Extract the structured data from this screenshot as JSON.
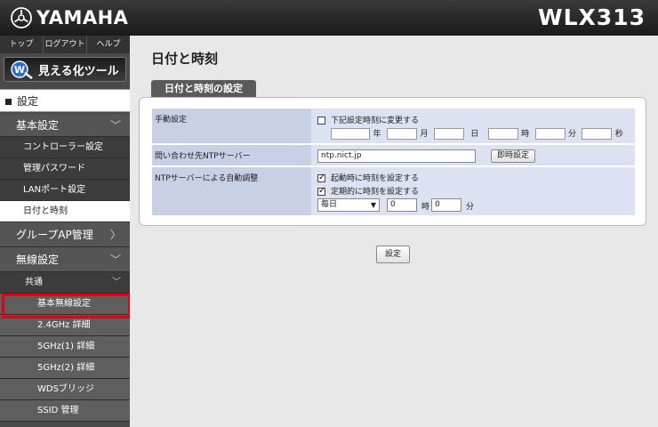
{
  "header": {
    "brand": "YAMAHA",
    "model": "WLX313"
  },
  "sidebar": {
    "top_links": [
      "トップ",
      "ログアウト",
      "ヘルプ"
    ],
    "viz_button": "見える化ツール",
    "section_title": "設定",
    "items": [
      {
        "label": "基本設定",
        "chevron": "﹀"
      },
      {
        "label": "コントローラー設定"
      },
      {
        "label": "管理パスワード"
      },
      {
        "label": "LANポート設定"
      },
      {
        "label": "日付と時刻"
      },
      {
        "label": "グループAP管理",
        "chevron": "〉"
      },
      {
        "label": "無線設定",
        "chevron": "﹀"
      },
      {
        "label": "共通",
        "chevron": "﹀"
      },
      {
        "label": "基本無線設定"
      },
      {
        "label": "2.4GHz 詳細"
      },
      {
        "label": "5GHz(1) 詳細"
      },
      {
        "label": "5GHz(2) 詳細"
      },
      {
        "label": "WDSブリッジ"
      },
      {
        "label": "SSID 管理"
      }
    ]
  },
  "main": {
    "title": "日付と時刻",
    "tab": "日付と時刻の設定",
    "manual": {
      "label": "手動設定",
      "checkbox": "下記設定時刻に変更する",
      "units": [
        "年",
        "月",
        "日",
        "時",
        "分",
        "秒"
      ]
    },
    "ntp_server": {
      "label": "問い合わせ先NTPサーバー",
      "value": "ntp.nict.jp",
      "button": "即時設定"
    },
    "auto": {
      "label": "NTPサーバーによる自動調整",
      "check1": "起動時に時刻を設定する",
      "check2": "定期的に時刻を設定する",
      "interval": "毎日",
      "hour_value": "0",
      "hour_unit": "時",
      "minute_value": "0",
      "minute_unit": "分"
    },
    "submit": "設定"
  }
}
